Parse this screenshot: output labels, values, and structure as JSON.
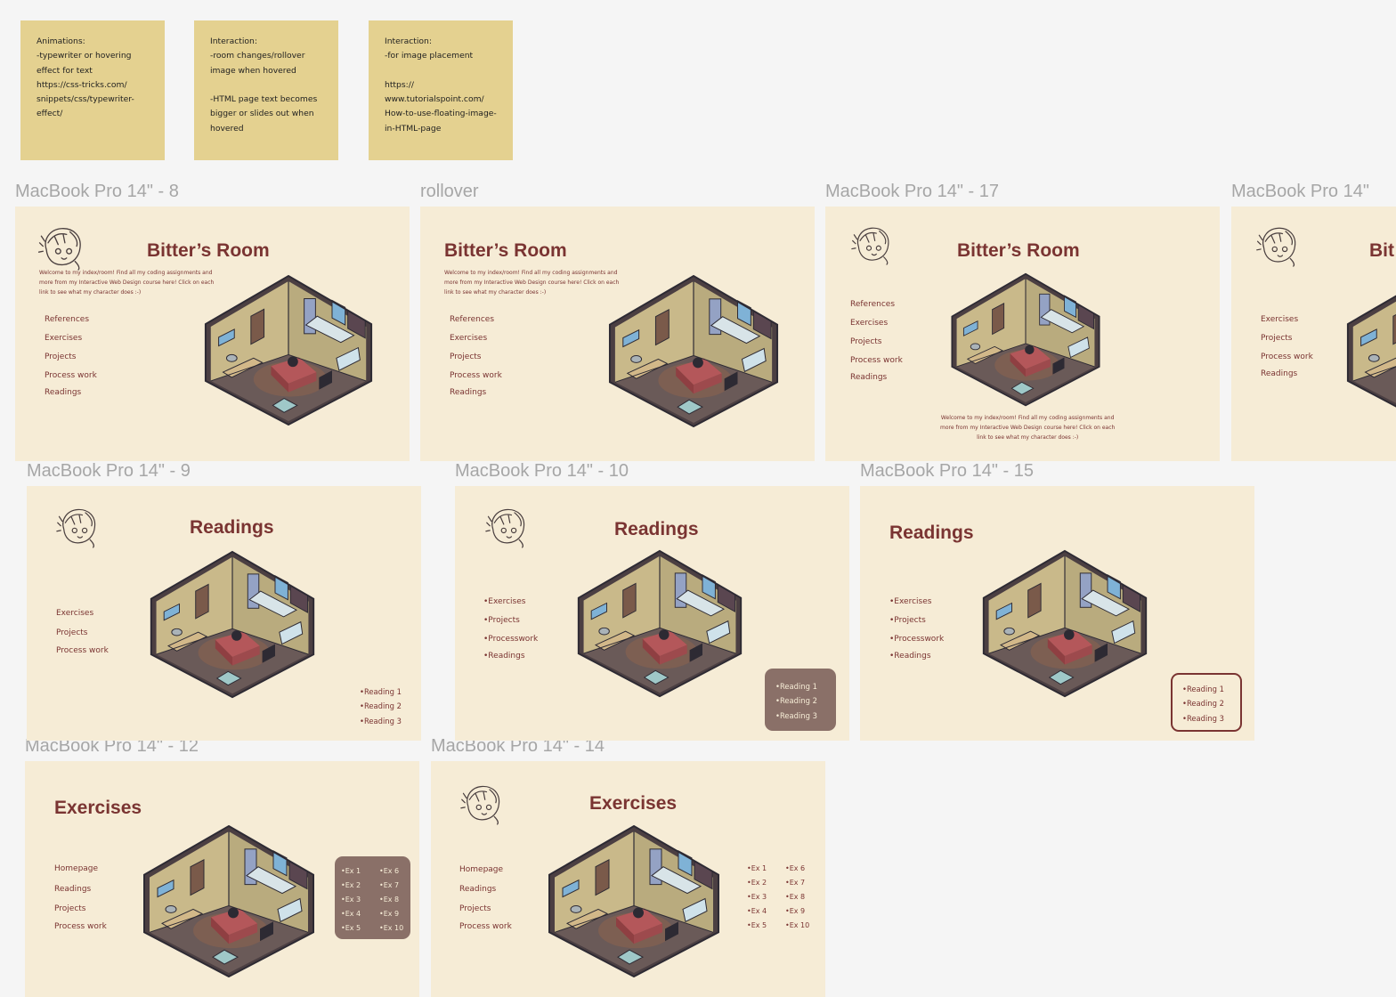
{
  "notes": [
    {
      "text": "Animations:\n-typewriter or hovering\neffect for text\nhttps://css-tricks.com/\nsnippets/css/typewriter-\neffect/"
    },
    {
      "text": "Interaction:\n-room changes/rollover\nimage when hovered\n\n-HTML page text becomes\nbigger or slides out when\nhovered"
    },
    {
      "text": "Interaction:\n-for image placement\n\nhttps://\nwww.tutorialspoint.com/\nHow-to-use-floating-image-\nin-HTML-page"
    }
  ],
  "frame_labels": {
    "f8": "MacBook Pro 14\" - 8",
    "rollover": "rollover",
    "f17": "MacBook Pro 14\" - 17",
    "f_partial": "MacBook Pro 14\"",
    "f9": "MacBook Pro 14\" - 9",
    "f10": "MacBook Pro 14\" - 10",
    "f15": "MacBook Pro 14\" - 15",
    "f12": "MacBook Pro 14\" - 12",
    "f14": "MacBook Pro 14\" - 14"
  },
  "home": {
    "title": "Bitter’s Room",
    "title_partial": "Bit",
    "intro": "Welcome to my index/room! Find all my coding assignments and\nmore from my Interactive Web Design course here! Click on each\nlink to see what my character does :-)",
    "nav": [
      "References",
      "Exercises",
      "Projects",
      "Process work",
      "Readings"
    ],
    "nav_partial": [
      "Exercises",
      "Projects",
      "Process work",
      "Readings"
    ]
  },
  "readings": {
    "title": "Readings",
    "nav_a": [
      "Exercises",
      "Projects",
      "Process work"
    ],
    "nav_b": [
      "•Exercises",
      "•Projects",
      "•Processwork",
      "•Readings"
    ],
    "items": [
      "•Reading 1",
      "•Reading 2",
      "•Reading 3"
    ]
  },
  "exercises": {
    "title": "Exercises",
    "nav": [
      "Homepage",
      "Readings",
      "Projects",
      "Process work"
    ],
    "col1": [
      "•Ex 1",
      "•Ex 2",
      "•Ex 3",
      "•Ex 4",
      "•Ex 5"
    ],
    "col2": [
      "•Ex 6",
      "•Ex 7",
      "•Ex 8",
      "•Ex 9",
      "•Ex 10"
    ]
  },
  "colors": {
    "canvas": "#f5f5f5",
    "frame": "#f6ecd6",
    "sticky": "#e4d190",
    "accent": "#7a3432",
    "chip": "#8a7068",
    "label": "#a6a6a6"
  }
}
